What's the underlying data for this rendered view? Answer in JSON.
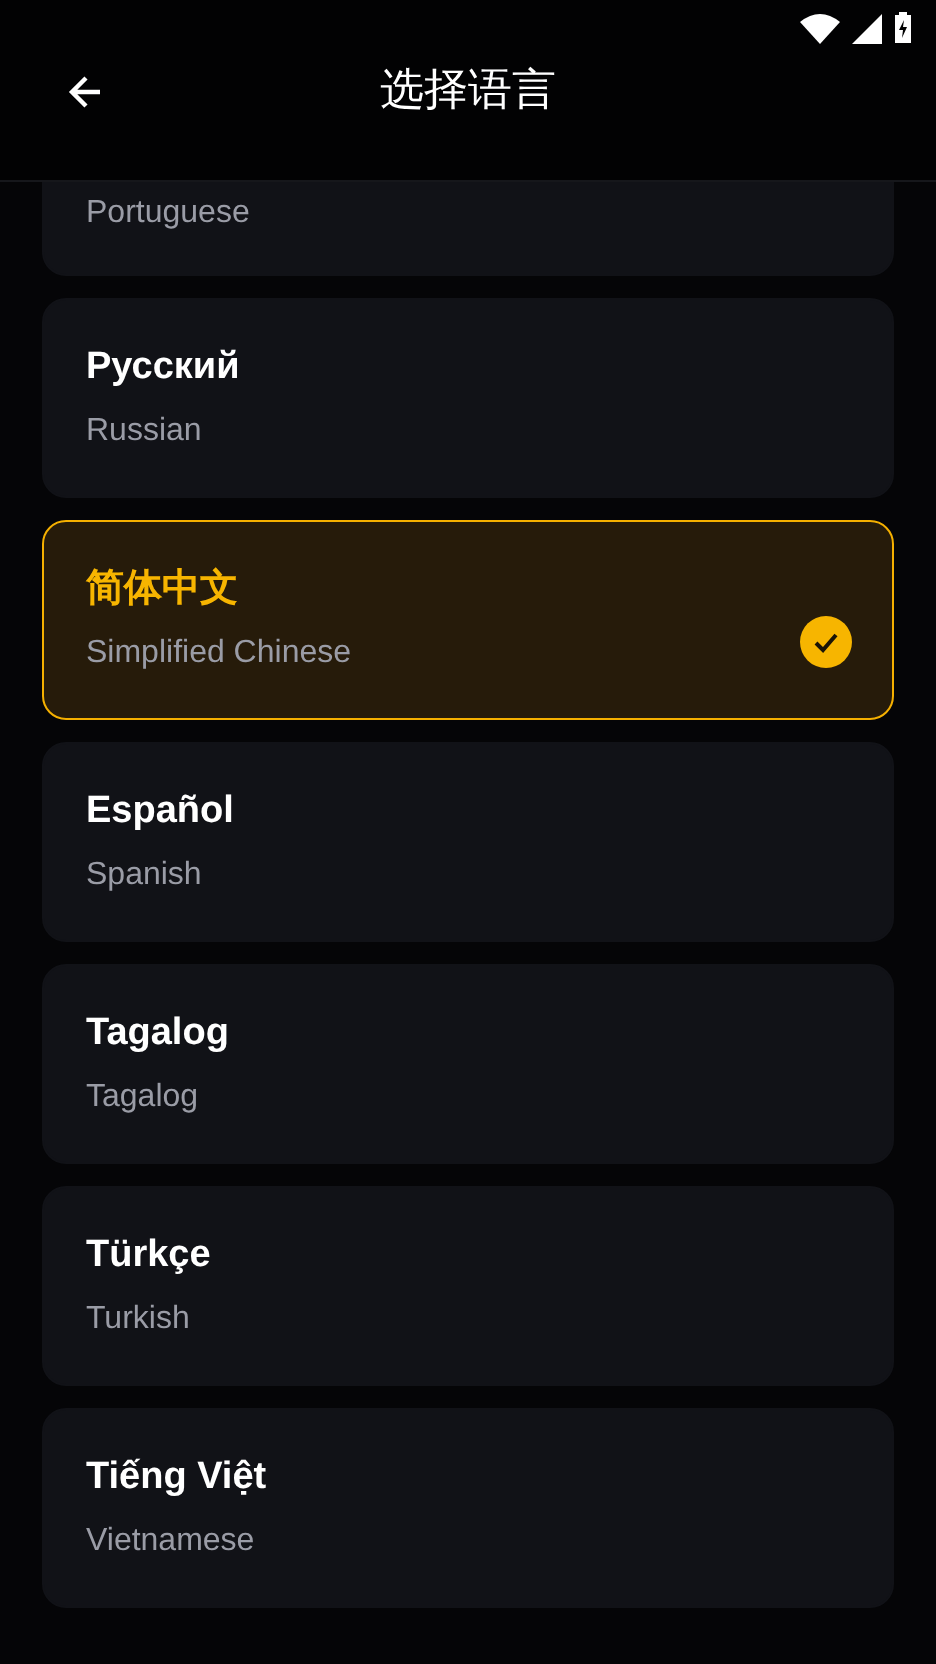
{
  "header": {
    "title": "选择语言"
  },
  "languages": [
    {
      "subtitle": "Portuguese",
      "selected": false
    },
    {
      "name": "Русский",
      "subtitle": "Russian",
      "selected": false
    },
    {
      "name": "简体中文",
      "subtitle": "Simplified Chinese",
      "selected": true
    },
    {
      "name": "Español",
      "subtitle": "Spanish",
      "selected": false
    },
    {
      "name": "Tagalog",
      "subtitle": "Tagalog",
      "selected": false
    },
    {
      "name": "Türkçe",
      "subtitle": "Turkish",
      "selected": false
    },
    {
      "name": "Tiếng Việt",
      "subtitle": "Vietnamese",
      "selected": false
    }
  ]
}
